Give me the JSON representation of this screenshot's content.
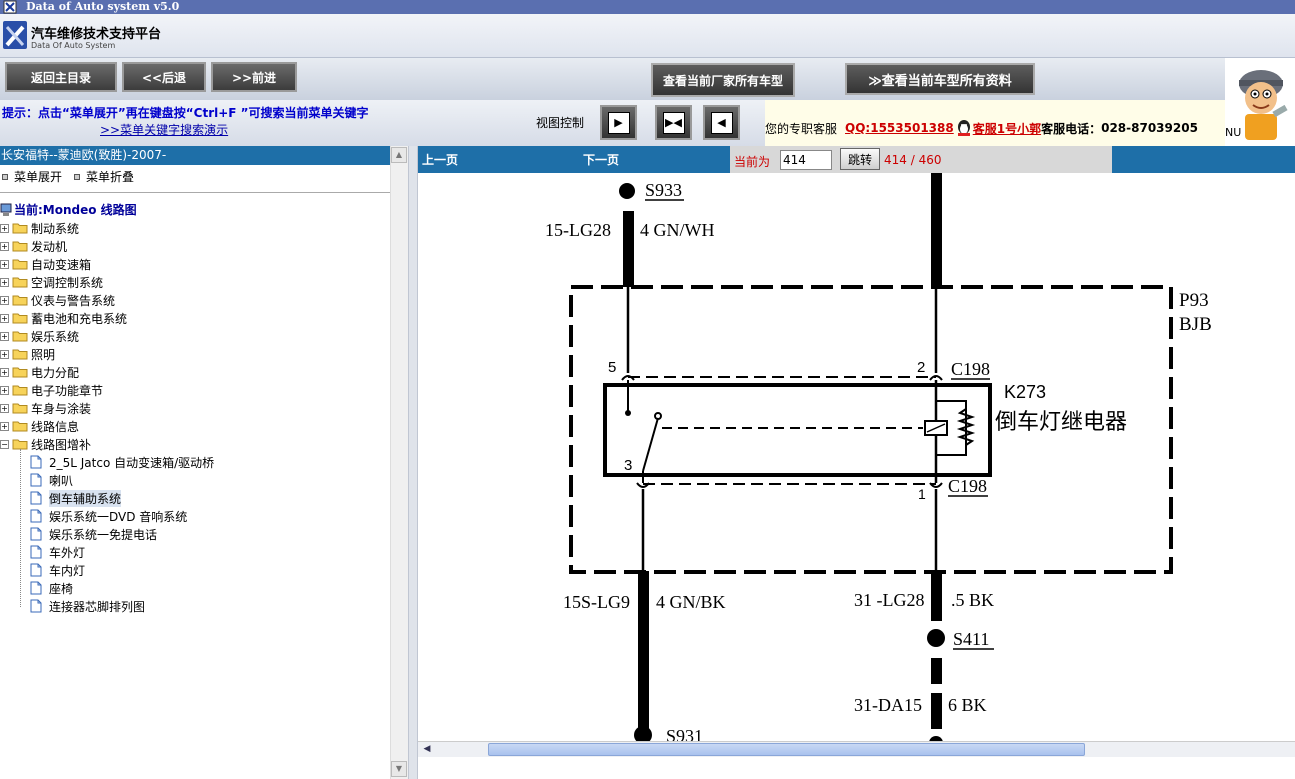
{
  "window": {
    "title": "Data of Auto system v5.0"
  },
  "header": {
    "app_name": "汽车维修技术支持平台",
    "app_sub": "Data Of Auto System"
  },
  "toolbar": {
    "home_label": "返回主目录",
    "back_label": "<<后退",
    "forward_label": ">>前进",
    "all_models_label": "查看当前厂家所有车型",
    "all_data_label": "≫查看当前车型所有资料"
  },
  "hint": {
    "text": "提示：点击“菜单展开”再在键盘按“Ctrl+F ”可搜索当前菜单关键字",
    "link": ">>菜单关键字搜索演示",
    "view_control": "视图控制"
  },
  "service": {
    "label": "您的专职客服",
    "qq": "QQ:1553501388",
    "agent": "客服1号小郭",
    "phone_label": "客服电话：",
    "phone": "028-87039205",
    "corner": "NU"
  },
  "sidebar": {
    "title": "长安福特--蒙迪欧(致胜)-2007-",
    "expand_label": "菜单展开",
    "collapse_label": "菜单折叠",
    "current": "当前:Mondeo 线路图",
    "folders": [
      "制动系统",
      "发动机",
      "自动变速箱",
      "空调控制系统",
      "仪表与警告系统",
      "蓄电池和充电系统",
      "娱乐系统",
      "照明",
      "电力分配",
      "电子功能章节",
      "车身与涂装",
      "线路信息",
      "线路图增补"
    ],
    "open_folder_index": 12,
    "pages": [
      "2_5L Jatco 自动变速箱/驱动桥",
      "喇叭",
      "倒车辅助系统",
      "娱乐系统一DVD 音响系统",
      "娱乐系统一免提电话",
      "车外灯",
      "车内灯",
      "座椅",
      "连接器芯脚排列图"
    ],
    "selected_page_index": 2
  },
  "pager": {
    "prev": "上一页",
    "next": "下一页",
    "current_label": "当前为",
    "page_value": "414",
    "jump_label": "跳转",
    "page_count": "414 / 460"
  },
  "diagram": {
    "splice_top": "S933",
    "wire_top_left_code": "15-LG28",
    "wire_top_left_spec": "4 GN/WH",
    "box_code": "P93",
    "box_name": "BJB",
    "pin5": "5",
    "pin2": "2",
    "pin3": "3",
    "pin1": "1",
    "conn_top": "C198",
    "conn_bottom": "C198",
    "relay_code": "K273",
    "relay_name": "倒车灯继电器",
    "wire_bottom_left_code": "15S-LG9",
    "wire_bottom_left_spec": "4 GN/BK",
    "wire_bottom_right_code": "31 -LG28",
    "wire_bottom_right_spec": ".5 BK",
    "splice_right": "S411",
    "wire_lower_right_code": "31-DA15",
    "wire_lower_right_spec": "6 BK",
    "splice_bottom": "S931"
  },
  "colors": {
    "title_bar": "#5a6fb0",
    "panel_header": "#1e6fa8",
    "hint_text": "#0000cc",
    "qq_text": "#cc0000",
    "pager_text": "#cc0000"
  }
}
